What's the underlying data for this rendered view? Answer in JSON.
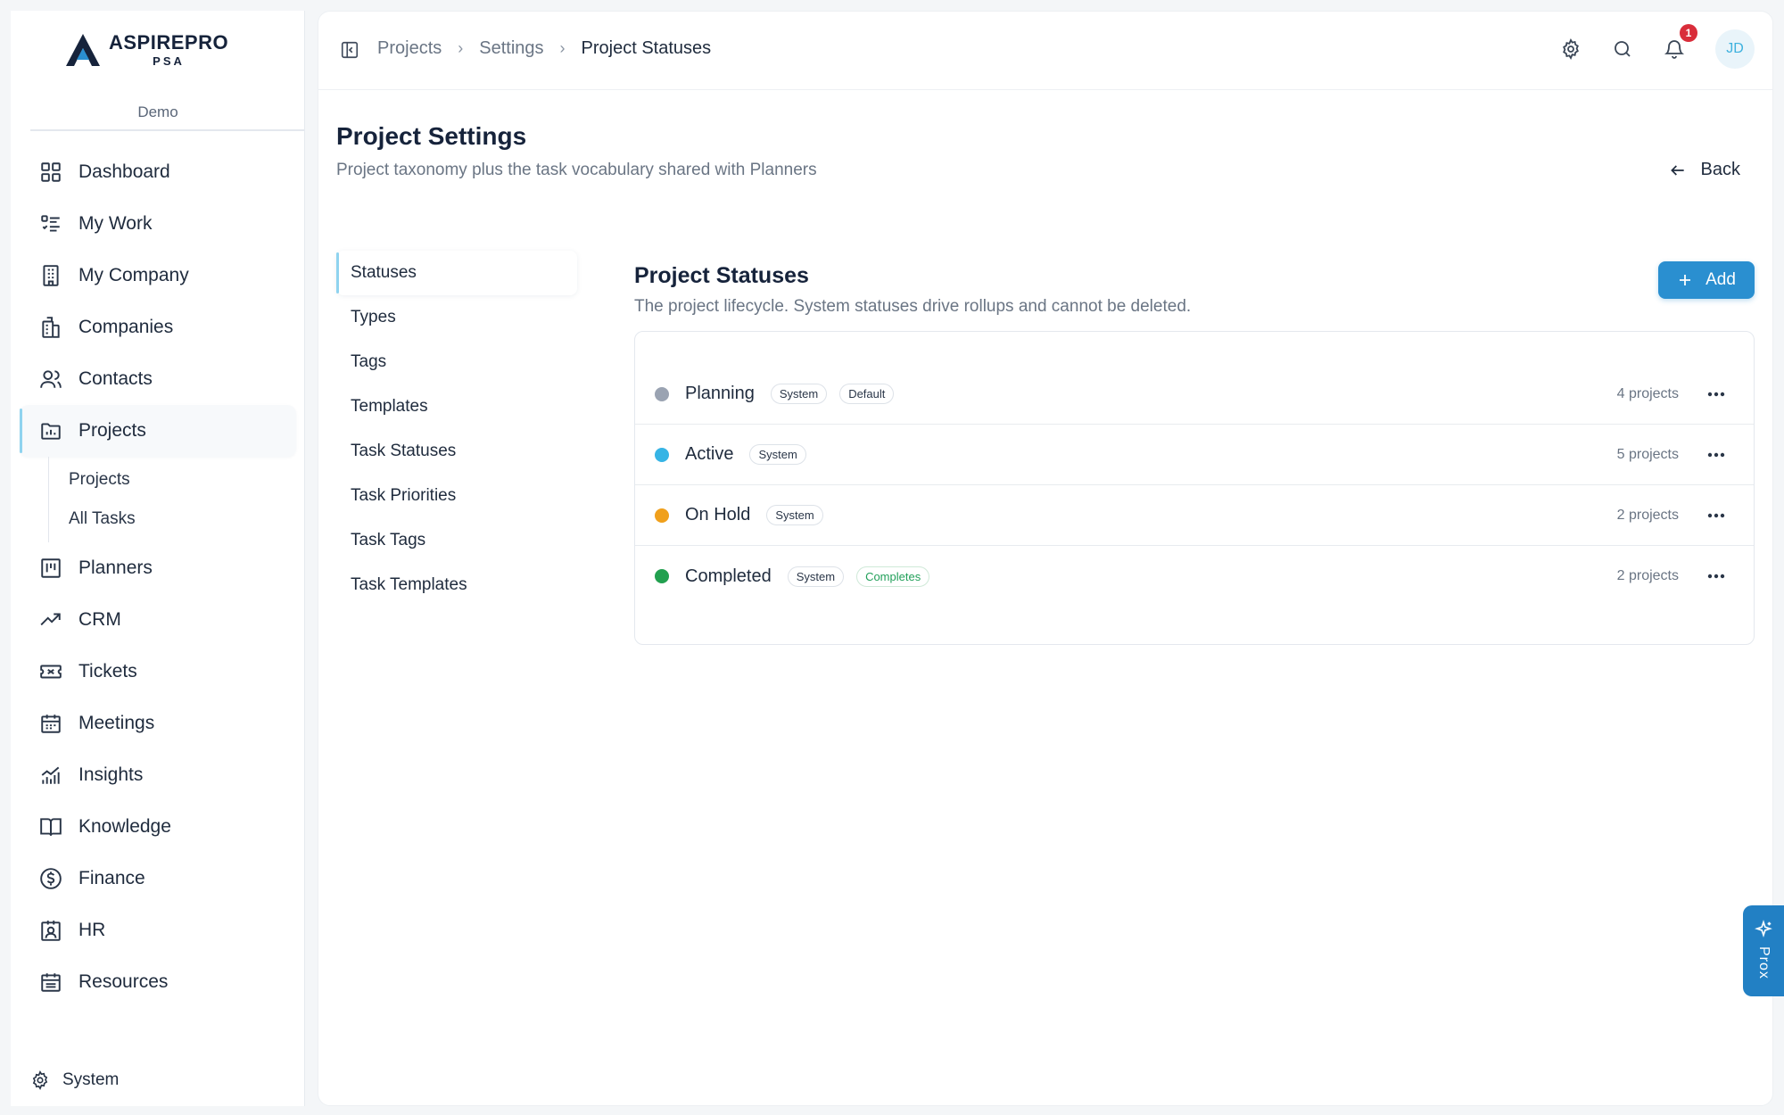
{
  "brand": {
    "name": "ASPIREPRO",
    "sub": "PSA",
    "workspace": "Demo"
  },
  "sidebar": {
    "items": [
      {
        "label": "Dashboard",
        "icon": "grid-icon"
      },
      {
        "label": "My Work",
        "icon": "checklist-icon"
      },
      {
        "label": "My Company",
        "icon": "building-icon"
      },
      {
        "label": "Companies",
        "icon": "buildings-icon"
      },
      {
        "label": "Contacts",
        "icon": "users-icon"
      },
      {
        "label": "Projects",
        "icon": "folder-chart-icon",
        "active": true
      },
      {
        "label": "Planners",
        "icon": "kanban-icon"
      },
      {
        "label": "CRM",
        "icon": "trend-icon"
      },
      {
        "label": "Tickets",
        "icon": "ticket-icon"
      },
      {
        "label": "Meetings",
        "icon": "calendar-icon"
      },
      {
        "label": "Insights",
        "icon": "chart-icon"
      },
      {
        "label": "Knowledge",
        "icon": "book-icon"
      },
      {
        "label": "Finance",
        "icon": "dollar-icon"
      },
      {
        "label": "HR",
        "icon": "badge-icon"
      },
      {
        "label": "Resources",
        "icon": "calendar-grid-icon"
      }
    ],
    "sub_items": [
      "Projects",
      "All Tasks"
    ],
    "system_label": "System"
  },
  "breadcrumb": [
    "Projects",
    "Settings",
    "Project Statuses"
  ],
  "notifications_count": "1",
  "avatar_initials": "JD",
  "page": {
    "title": "Project Settings",
    "subtitle": "Project taxonomy plus the task vocabulary shared with Planners",
    "back_label": "Back"
  },
  "settings_nav": [
    "Statuses",
    "Types",
    "Tags",
    "Templates",
    "Task Statuses",
    "Task Priorities",
    "Task Tags",
    "Task Templates"
  ],
  "statuses_section": {
    "title": "Project Statuses",
    "subtitle": "The project lifecycle. System statuses drive rollups and cannot be deleted.",
    "add_label": "Add",
    "rows": [
      {
        "name": "Planning",
        "color": "#9aa3b2",
        "tags": [
          "System",
          "Default"
        ],
        "count": "4 projects"
      },
      {
        "name": "Active",
        "color": "#36b4e5",
        "tags": [
          "System"
        ],
        "count": "5 projects"
      },
      {
        "name": "On Hold",
        "color": "#f0a01c",
        "tags": [
          "System"
        ],
        "count": "2 projects"
      },
      {
        "name": "Completed",
        "color": "#22a04f",
        "tags": [
          "System",
          "Completes"
        ],
        "count": "2 projects"
      }
    ]
  },
  "prox_label": "Prox",
  "colors": {
    "accent": "#2a8fd0",
    "active_indicator": "#8fd3ef",
    "badge": "#d92d3a"
  }
}
